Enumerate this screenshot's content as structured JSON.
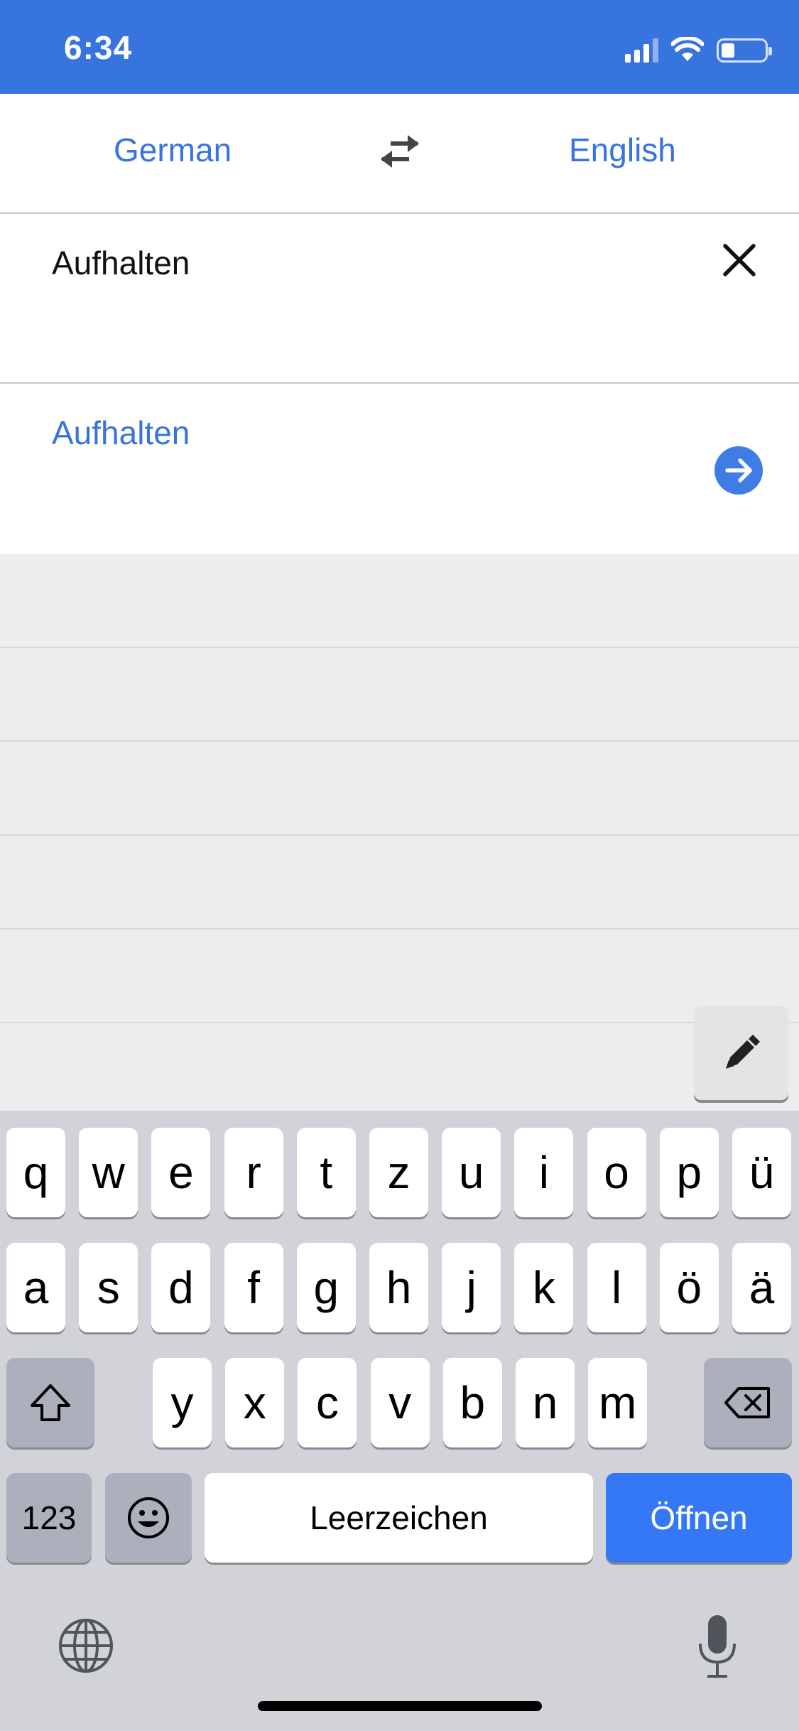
{
  "status_bar": {
    "time": "6:34"
  },
  "language_bar": {
    "source": "German",
    "target": "English"
  },
  "input": {
    "text": "Aufhalten"
  },
  "result": {
    "text": "Aufhalten"
  },
  "keyboard": {
    "row1": [
      "q",
      "w",
      "e",
      "r",
      "t",
      "z",
      "u",
      "i",
      "o",
      "p",
      "ü"
    ],
    "row2": [
      "a",
      "s",
      "d",
      "f",
      "g",
      "h",
      "j",
      "k",
      "l",
      "ö",
      "ä"
    ],
    "row3": [
      "y",
      "x",
      "c",
      "v",
      "b",
      "n",
      "m"
    ],
    "numbers_label": "123",
    "space_label": "Leerzeichen",
    "return_label": "Öffnen"
  },
  "colors": {
    "accent": "#3874de",
    "return_key": "#3478f6"
  }
}
